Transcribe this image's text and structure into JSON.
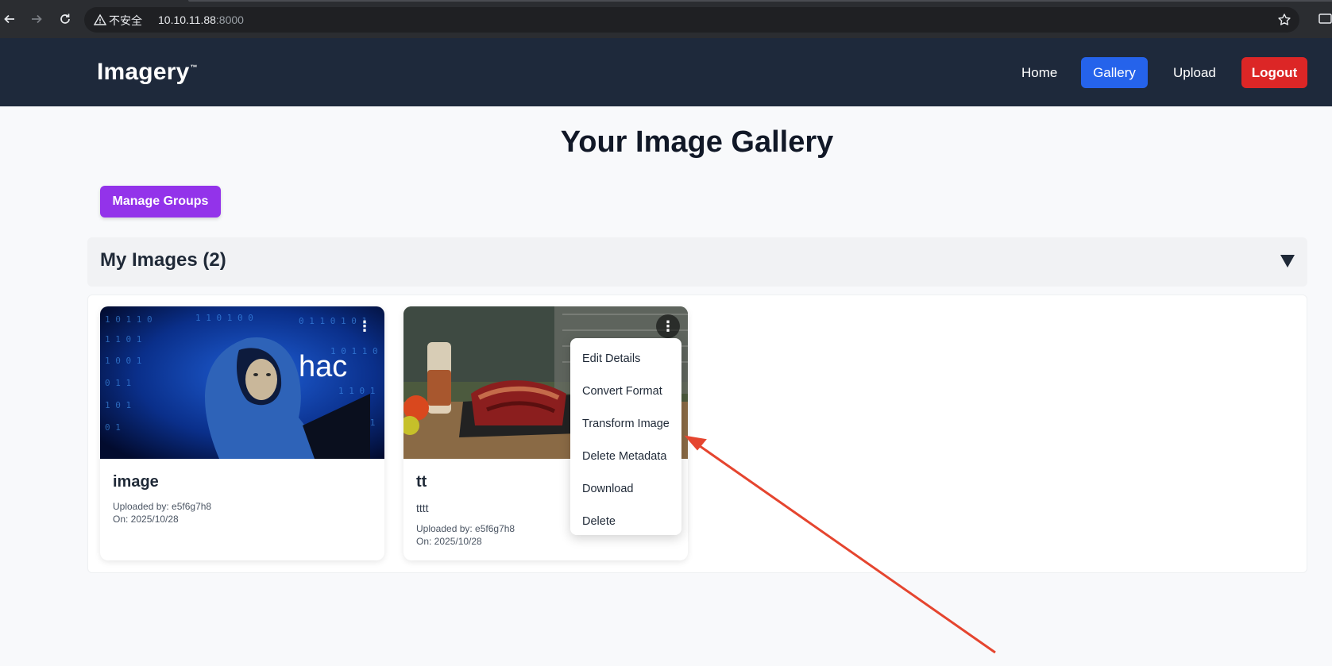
{
  "browser": {
    "insecure_label": "不安全",
    "url_host": "10.10.11.88",
    "url_port": ":8000"
  },
  "header": {
    "logo": "Imagery",
    "logo_tm": "™",
    "nav": {
      "home": "Home",
      "gallery": "Gallery",
      "upload": "Upload",
      "logout": "Logout"
    }
  },
  "main": {
    "title": "Your Image Gallery",
    "manage_groups": "Manage Groups",
    "section_title": "My Images (2)",
    "cards": [
      {
        "title": "image",
        "overlay_text": "hac",
        "uploaded_by": "Uploaded by: e5f6g7h8",
        "date": "On: 2025/10/28"
      },
      {
        "title": "tt",
        "description": "tttt",
        "uploaded_by": "Uploaded by: e5f6g7h8",
        "date": "On: 2025/10/28"
      }
    ],
    "menu": [
      "Edit Details",
      "Convert Format",
      "Transform Image",
      "Delete Metadata",
      "Download",
      "Delete"
    ]
  },
  "icons": {
    "back": "arrow-left-icon",
    "forward": "arrow-right-icon",
    "reload": "reload-icon",
    "warning": "warning-icon",
    "bookmark": "star-icon",
    "kebab": "more-vertical-icon",
    "toggle": "triangle-down-icon"
  },
  "colors": {
    "header_bg": "#1e293b",
    "gallery_btn": "#2563eb",
    "logout_btn": "#dc2626",
    "manage_btn": "#9333ea",
    "arrow": "#e5452f"
  }
}
